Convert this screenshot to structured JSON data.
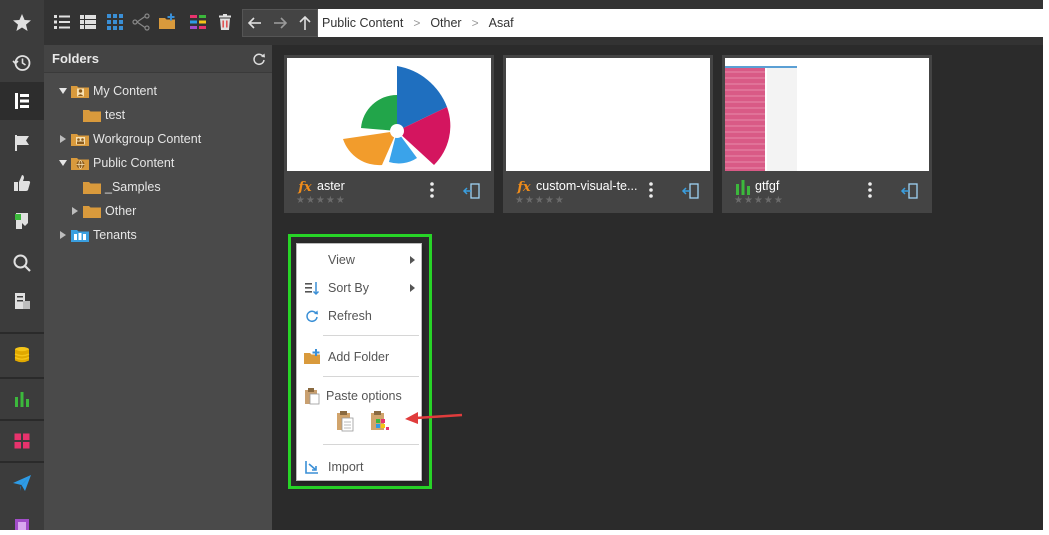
{
  "toolbar": {
    "breadcrumb": [
      {
        "label": "Public Content"
      },
      {
        "label": "Other"
      },
      {
        "label": "Asaf"
      }
    ],
    "breadcrumb_separator": ">"
  },
  "folders_panel": {
    "title": "Folders",
    "tree": [
      {
        "label": "My Content",
        "expanded": true,
        "icon": "user-folder-icon"
      },
      {
        "label": "test",
        "icon": "folder-icon"
      },
      {
        "label": "Workgroup Content",
        "expanded": false,
        "icon": "group-folder-icon"
      },
      {
        "label": "Public Content",
        "expanded": true,
        "icon": "globe-folder-icon"
      },
      {
        "label": "_Samples",
        "icon": "folder-icon"
      },
      {
        "label": "Other",
        "expanded": false,
        "icon": "folder-icon"
      },
      {
        "label": "Tenants",
        "expanded": false,
        "icon": "tenant-folder-icon"
      }
    ]
  },
  "cards": [
    {
      "name": "aster",
      "type_icon": "fx-icon",
      "rating": 0
    },
    {
      "name": "custom-visual-te...",
      "type_icon": "fx-icon",
      "rating": 0
    },
    {
      "name": "gtfgf",
      "type_icon": "bar-chart-icon",
      "rating": 0
    }
  ],
  "context_menu": {
    "view": "View",
    "sort_by": "Sort By",
    "refresh": "Refresh",
    "add_folder": "Add Folder",
    "paste_options": "Paste options",
    "import": "Import"
  },
  "colors": {
    "rail": "#3c3c3c",
    "panel": "#4a4a4a",
    "content_bg": "#2b2b2b",
    "highlight_green": "#27d427",
    "annotation_red": "#e03c3c",
    "fx_orange": "#f08c1a",
    "chart_green": "#3cb83c"
  }
}
